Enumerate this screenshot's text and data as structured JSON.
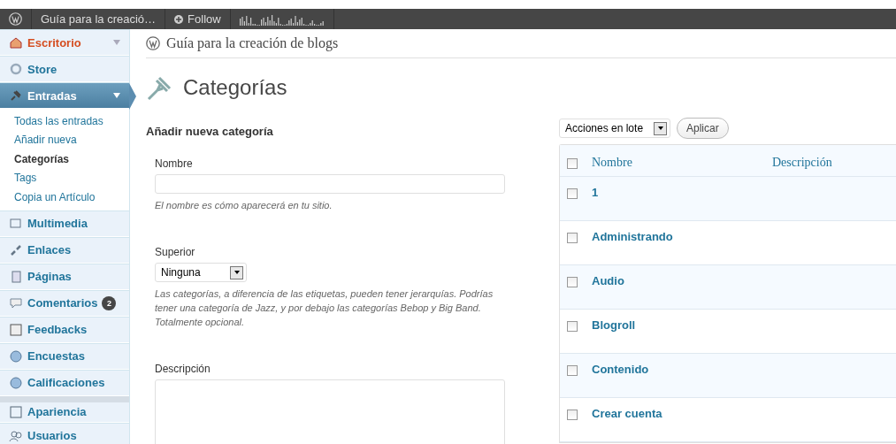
{
  "admin_bar": {
    "site": "Guía para la creació…",
    "follow": "Follow"
  },
  "sidebar": {
    "items": [
      {
        "label": "Escritorio",
        "highlighted": true,
        "selected": false,
        "arrow": true
      },
      {
        "label": "Store",
        "highlighted": false,
        "selected": false,
        "arrow": false
      },
      {
        "label": "Entradas",
        "highlighted": false,
        "selected": true,
        "arrow": true,
        "children": [
          {
            "label": "Todas las entradas",
            "selected": false
          },
          {
            "label": "Añadir nueva",
            "selected": false
          },
          {
            "label": "Categorías",
            "selected": true
          },
          {
            "label": "Tags",
            "selected": false
          },
          {
            "label": "Copia un Artículo",
            "selected": false
          }
        ]
      },
      {
        "label": "Multimedia",
        "highlighted": false,
        "selected": false,
        "arrow": false
      },
      {
        "label": "Enlaces",
        "highlighted": false,
        "selected": false,
        "arrow": false
      },
      {
        "label": "Páginas",
        "highlighted": false,
        "selected": false,
        "arrow": false
      },
      {
        "label": "Comentarios",
        "highlighted": false,
        "selected": false,
        "arrow": false,
        "badge": "2"
      },
      {
        "label": "Feedbacks",
        "highlighted": false,
        "selected": false,
        "arrow": false
      },
      {
        "label": "Encuestas",
        "highlighted": false,
        "selected": false,
        "arrow": false
      },
      {
        "label": "Calificaciones",
        "highlighted": false,
        "selected": false,
        "arrow": false
      },
      {
        "label": "Apariencia",
        "highlighted": false,
        "selected": false,
        "arrow": false,
        "separator_before": true
      },
      {
        "label": "Usuarios",
        "highlighted": false,
        "selected": false,
        "arrow": false
      }
    ]
  },
  "site_title": "Guía para la creación de blogs",
  "page_title": "Categorías",
  "form": {
    "title": "Añadir nueva categoría",
    "name": {
      "label": "Nombre",
      "hint": "El nombre es cómo aparecerá en tu sitio."
    },
    "parent": {
      "label": "Superior",
      "value": "Ninguna",
      "hint": "Las categorías, a diferencia de las etiquetas, pueden tener jerarquías. Podrías tener una categoría de Jazz, y por debajo las categorías Bebop y Big Band. Totalmente opcional."
    },
    "description": {
      "label": "Descripción"
    }
  },
  "bulk": {
    "value": "Acciones en lote",
    "apply": "Aplicar"
  },
  "table": {
    "header_checked": false,
    "columns": [
      "Nombre",
      "Descripción"
    ],
    "rows": [
      {
        "name": "1",
        "checked": false
      },
      {
        "name": "Administrando",
        "checked": false
      },
      {
        "name": "Audio",
        "checked": false
      },
      {
        "name": "Blogroll",
        "checked": false
      },
      {
        "name": "Contenido",
        "checked": false
      },
      {
        "name": "Crear cuenta",
        "checked": false
      }
    ]
  }
}
